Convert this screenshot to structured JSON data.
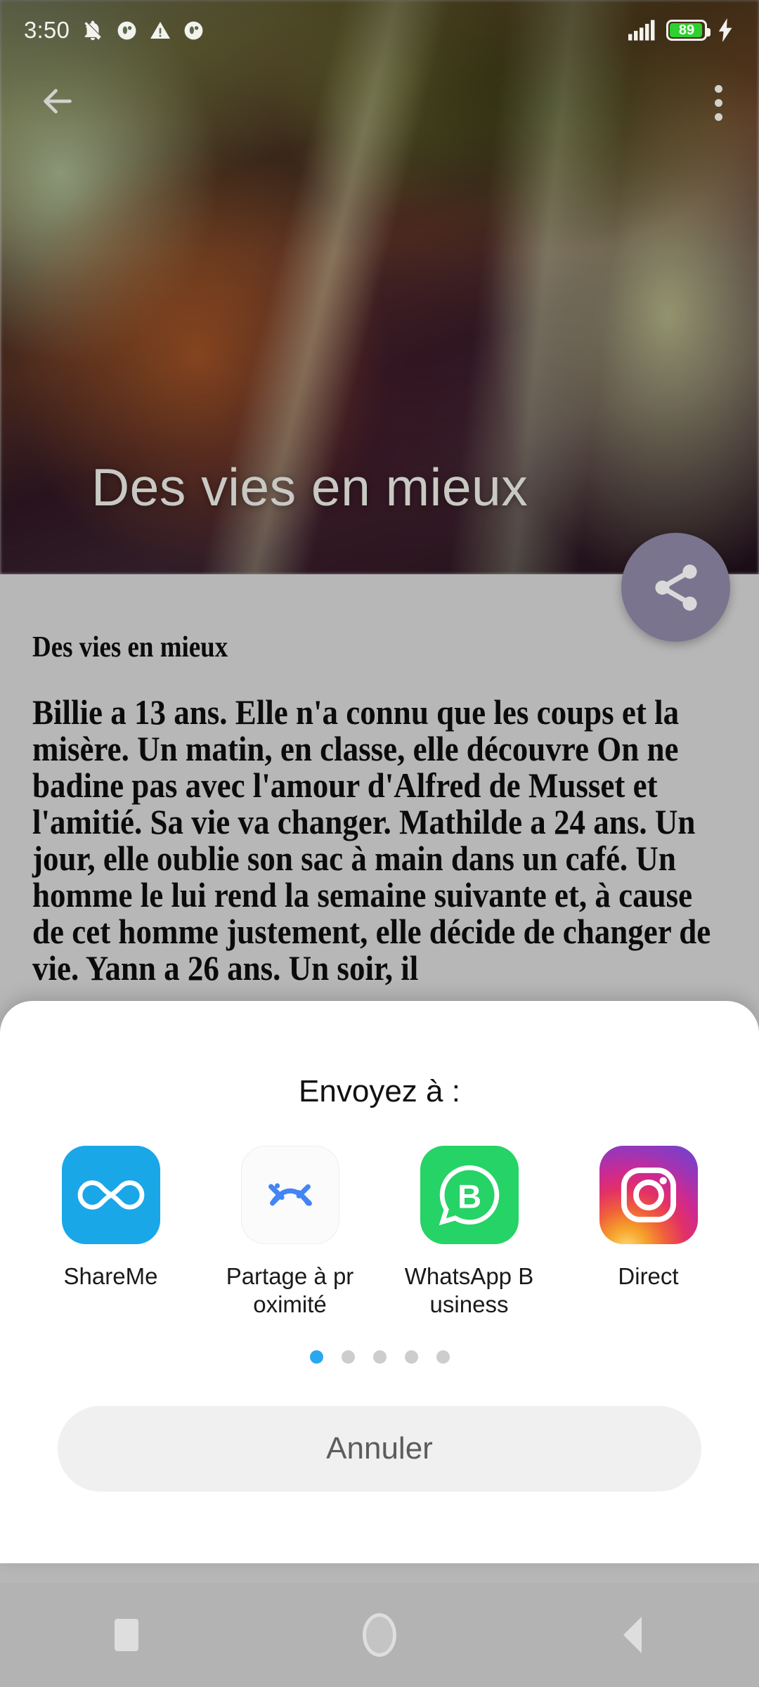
{
  "statusbar": {
    "clock": "3:50",
    "icons_left": [
      "vibrate-off-icon",
      "app-notification-icon",
      "warning-triangle-icon",
      "app-notification-icon"
    ],
    "signal": "signal-bars-icon",
    "battery_percent": "89",
    "battery_level": 89,
    "charging": true,
    "charging_icon": "lightning-bolt-icon"
  },
  "appbar": {
    "back_icon": "back-arrow-icon",
    "overflow_icon": "three-dot-menu-icon"
  },
  "hero": {
    "title": "Des vies en mieux",
    "image": "blurred-open-book-photo"
  },
  "fab": {
    "icon": "share-icon",
    "color": "#7a748e"
  },
  "article": {
    "title": "Des vies en mieux",
    "body": "Billie a 13 ans. Elle n'a connu que les coups et la misère. Un matin, en classe, elle découvre On ne badine pas avec l'amour d'Alfred de Musset et l'amitié. Sa vie va changer. Mathilde a 24 ans. Un jour, elle oublie son sac à main dans un café. Un homme le lui rend la semaine suivante et, à cause de cet homme justement, elle décide de changer de vie. Yann a 26 ans. Un soir, il"
  },
  "share_sheet": {
    "title": "Envoyez à :",
    "apps": [
      {
        "label": "ShareMe",
        "icon": "shareme-infinity-icon"
      },
      {
        "label": "Partage à proximité",
        "icon": "nearby-share-icon"
      },
      {
        "label": "WhatsApp Business",
        "icon": "whatsapp-business-icon"
      },
      {
        "label": "Direct",
        "icon": "instagram-direct-icon"
      }
    ],
    "pager": {
      "count": 5,
      "active_index": 0,
      "active_color": "#29a7ef",
      "inactive_color": "#cdcdcd"
    },
    "cancel_label": "Annuler"
  },
  "navbar": {
    "recents_icon": "square-recents-icon",
    "home_icon": "circle-home-icon",
    "back_icon": "triangle-back-icon"
  }
}
